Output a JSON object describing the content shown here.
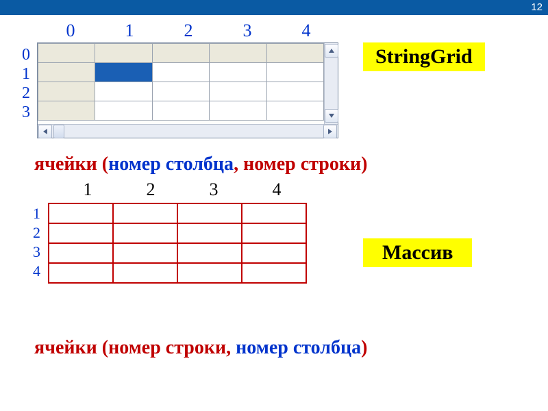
{
  "page_number": "12",
  "stringgrid": {
    "col_labels": [
      "0",
      "1",
      "2",
      "3",
      "4"
    ],
    "row_labels": [
      "0",
      "1",
      "2",
      "3"
    ],
    "rows": 4,
    "cols": 5,
    "fixed_rows": 1,
    "fixed_cols": 1,
    "selected": {
      "row": 1,
      "col": 1
    }
  },
  "array": {
    "col_labels": [
      "1",
      "2",
      "3",
      "4"
    ],
    "row_labels": [
      "1",
      "2",
      "3",
      "4"
    ],
    "rows": 4,
    "cols": 4
  },
  "labels": {
    "stringgrid": "StringGrid",
    "array": "Массив"
  },
  "captions": {
    "c1_p1": "ячейки (",
    "c1_p2": "номер столбца",
    "c1_p3": ", ",
    "c1_p4": "номер строки",
    "c1_p5": ")",
    "c2_p1": "ячейки (",
    "c2_p2": "номер строки",
    "c2_p3": ", ",
    "c2_p4": "номер столбца",
    "c2_p5": ")"
  }
}
